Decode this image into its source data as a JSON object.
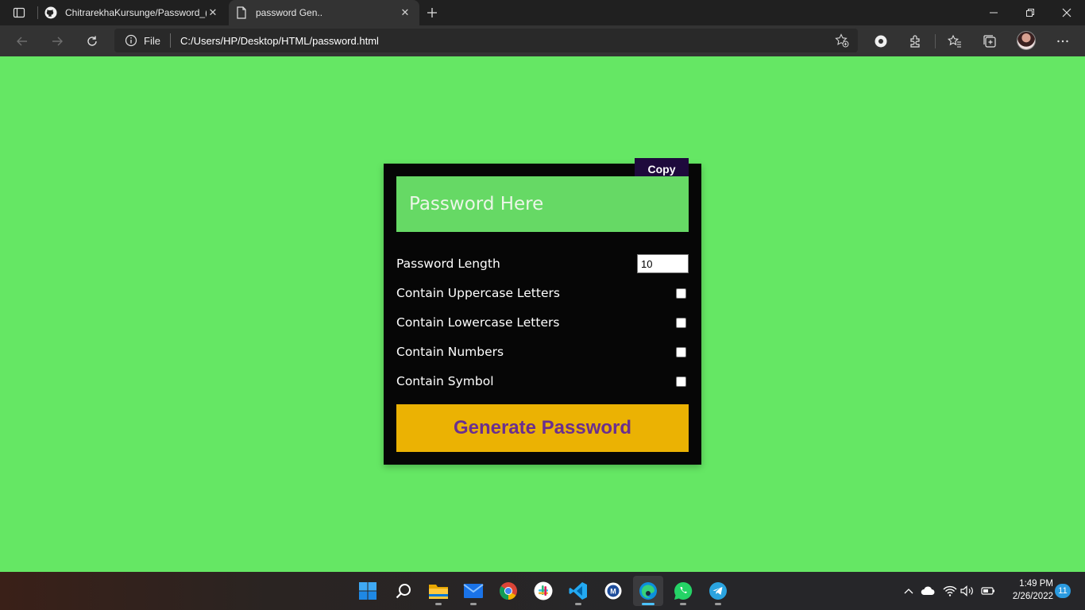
{
  "browser": {
    "tabs": [
      {
        "title": "ChitrarekhaKursunge/Password_(",
        "icon": "github-icon",
        "active": false
      },
      {
        "title": "password Gen..",
        "icon": "page-icon",
        "active": true
      }
    ],
    "address": {
      "scheme_label": "File",
      "url": "C:/Users/HP/Desktop/HTML/password.html"
    }
  },
  "app": {
    "copy_label": "Copy",
    "password_placeholder": "Password Here",
    "options": {
      "length_label": "Password Length",
      "length_value": "10",
      "uppercase_label": "Contain Uppercase Letters",
      "lowercase_label": "Contain Lowercase Letters",
      "numbers_label": "Contain Numbers",
      "symbol_label": "Contain Symbol",
      "uppercase_checked": false,
      "lowercase_checked": false,
      "numbers_checked": false,
      "symbol_checked": false
    },
    "generate_label": "Generate Password",
    "colors": {
      "page_bg": "#65e764",
      "card_bg": "#060606",
      "display_bg": "#66d965",
      "copy_bg": "#1e0a3c",
      "generate_bg": "#ebb203",
      "generate_text": "#6a2f8f"
    }
  },
  "taskbar": {
    "apps": [
      "start-icon",
      "search-icon",
      "file-explorer-icon",
      "mail-icon",
      "chrome-icon",
      "slack-icon",
      "vscode-icon",
      "app-icon",
      "edge-icon",
      "whatsapp-icon",
      "telegram-icon"
    ],
    "time": "1:49 PM",
    "date": "2/26/2022",
    "notification_count": "11"
  }
}
